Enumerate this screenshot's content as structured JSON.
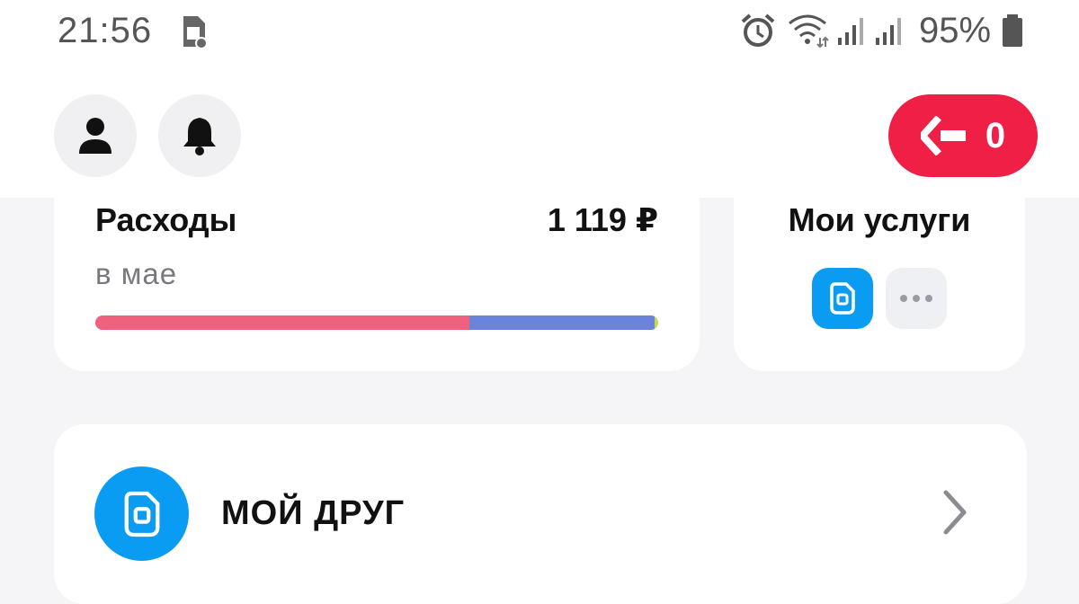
{
  "statusbar": {
    "time": "21:56",
    "battery": "95%",
    "icons": [
      "sim-settings-icon",
      "alarm-icon",
      "wifi-icon",
      "signal-icon",
      "signal-icon",
      "battery-icon"
    ]
  },
  "header": {
    "profile_icon": "person-icon",
    "notifications_icon": "bell-icon",
    "bonus_icon": "arrow-left-logo-icon",
    "bonus_count": "0"
  },
  "expenses": {
    "title": "Расходы",
    "amount": "1 119 ₽",
    "period": "в мае",
    "bar_segments": [
      {
        "share": 0.665,
        "color": "#f0607f"
      },
      {
        "share": 0.328,
        "color": "#6a83db"
      },
      {
        "share": 0.007,
        "color": "#c7d94a"
      }
    ]
  },
  "services": {
    "title": "Мои услуги",
    "items": [
      {
        "icon": "sim-card-icon",
        "color": "#0a9cf2"
      },
      {
        "icon": "more-icon",
        "color": "#eff0f3"
      }
    ]
  },
  "friend": {
    "title": "МОЙ ДРУГ",
    "icon": "sim-card-icon",
    "chevron": "chevron-right-icon"
  },
  "colors": {
    "accent_red": "#ef1f46",
    "accent_blue": "#0a9cf2",
    "background": "#f5f5f7"
  }
}
